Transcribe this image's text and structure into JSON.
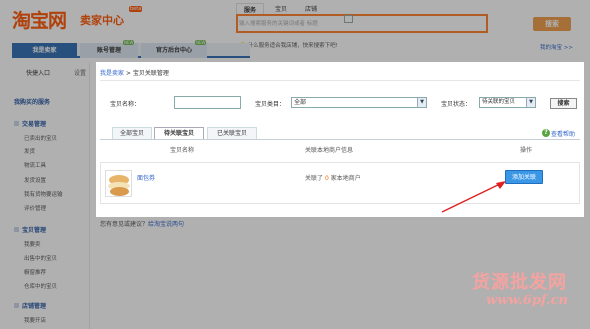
{
  "header": {
    "logo_text": "淘宝网",
    "logo_sub": "卖家中心",
    "beta": "beta",
    "search_tabs": [
      "服务",
      "宝贝",
      "店铺"
    ],
    "search_placeholder": "输入搜索服务的关键词或者 标题",
    "search_button": "搜索",
    "hint": "什么服务适合我店铺，快来搜索下吧!",
    "help_link": "我的淘宝 >>"
  },
  "nav": {
    "tabs": [
      "我是卖家",
      "账号管理",
      "官方后台中心"
    ],
    "new_badge": "NEW"
  },
  "sidebar": {
    "quick_entry": "快捷入口",
    "settings": "设置",
    "bought": "我购买的服务",
    "sections": [
      {
        "title": "交易管理",
        "items": [
          "已卖出的宝贝",
          "发货",
          "物流工具",
          "发货设置",
          "我有货物要运输",
          "评价管理"
        ]
      },
      {
        "title": "宝贝管理",
        "items": [
          "我要卖",
          "出售中的宝贝",
          "橱窗推荐",
          "仓库中的宝贝"
        ]
      },
      {
        "title": "店铺管理",
        "items": [
          "我要开店"
        ]
      }
    ]
  },
  "panel": {
    "breadcrumb_link": "我是卖家",
    "breadcrumb_sep": " > ",
    "breadcrumb_current": "宝贝关联管理",
    "filter": {
      "name_label": "宝贝名称：",
      "name_value": "",
      "category_label": "宝贝类目：",
      "category_value": "全部",
      "status_label": "宝贝状态：",
      "status_value": "待关联的宝贝",
      "search_button": "搜索"
    },
    "tabs": [
      "全部宝贝",
      "待关联宝贝",
      "已关联宝贝"
    ],
    "view_help": "查看帮助",
    "columns": [
      "宝贝名称",
      "关联本地商户信息",
      "操作"
    ],
    "rows": [
      {
        "name": "面包券",
        "info_prefix": "关联了",
        "info_count": "0",
        "info_suffix": "家本地商户",
        "action": "添加关联"
      }
    ]
  },
  "below": {
    "text_prefix": "您有意见或建议？",
    "link": "给淘宝说两句"
  },
  "watermark": {
    "line1": "货源批发网",
    "line2": "www.6pf.cn"
  }
}
